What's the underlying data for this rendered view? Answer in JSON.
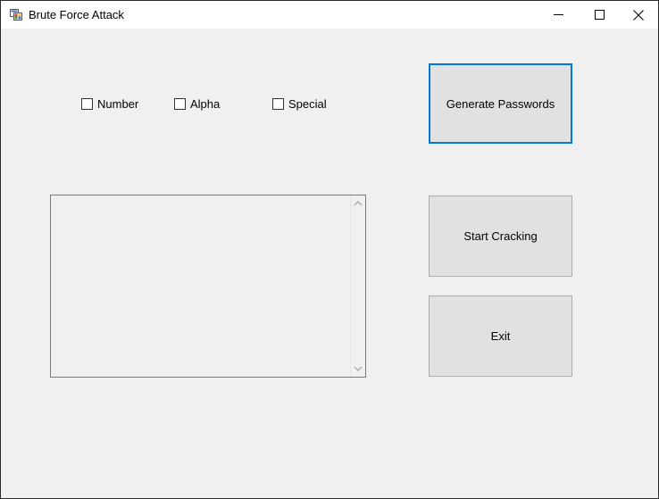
{
  "window": {
    "title": "Brute Force Attack",
    "controls": {
      "minimize_icon": "minimize-icon",
      "maximize_icon": "maximize-icon",
      "close_icon": "close-icon"
    }
  },
  "options": {
    "number_label": "Number",
    "alpha_label": "Alpha",
    "special_label": "Special",
    "number_checked": false,
    "alpha_checked": false,
    "special_checked": false
  },
  "output": {
    "value": ""
  },
  "buttons": {
    "generate_label": "Generate Passwords",
    "start_label": "Start Cracking",
    "exit_label": "Exit"
  },
  "colors": {
    "window_bg": "#f0f0f0",
    "button_bg": "#e1e1e1",
    "focus_border": "#0078d7"
  }
}
